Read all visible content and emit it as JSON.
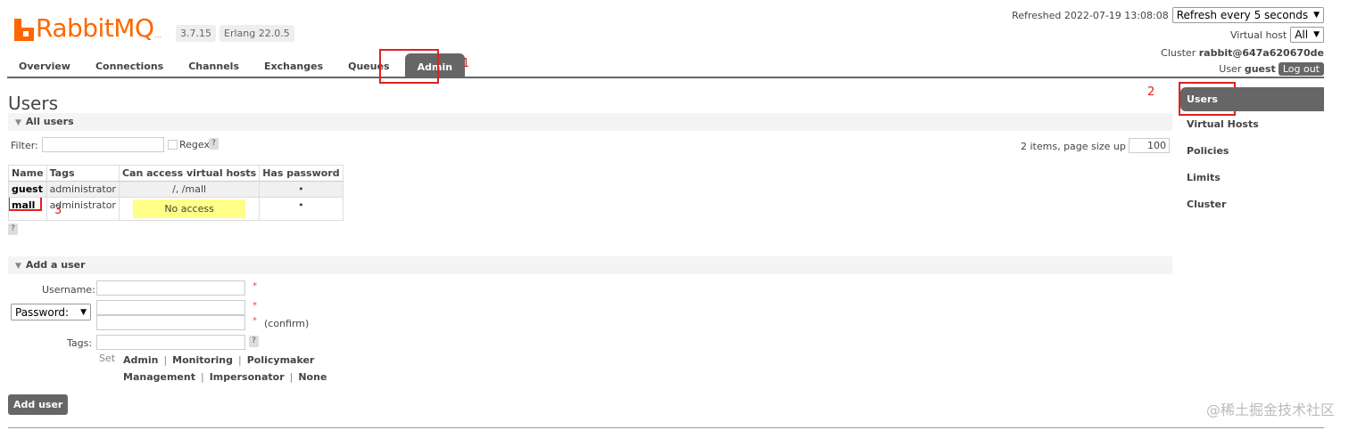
{
  "header": {
    "logo_text": "RabbitMQ",
    "logo_dots": "...",
    "version": "3.7.15",
    "erlang": "Erlang 22.0.5",
    "refreshed_label": "Refreshed 2022-07-19 13:08:08",
    "refresh_select": "Refresh every 5 seconds",
    "vhost_label": "Virtual host",
    "vhost_select": "All",
    "cluster_label": "Cluster",
    "cluster_name": "rabbit@647a620670de",
    "user_label": "User",
    "user_name": "guest",
    "logout": "Log out"
  },
  "nav": {
    "tabs": [
      "Overview",
      "Connections",
      "Channels",
      "Exchanges",
      "Queues",
      "Admin"
    ],
    "active": "Admin"
  },
  "sidebar": {
    "items": [
      "Users",
      "Virtual Hosts",
      "Policies",
      "Limits",
      "Cluster"
    ],
    "active": "Users"
  },
  "annotations": [
    "1",
    "2",
    "3"
  ],
  "page": {
    "title": "Users",
    "all_users_section": "All users",
    "filter_label": "Filter:",
    "regex_label": "Regex",
    "help": "?",
    "pagination": "2 items, page size up to",
    "page_size": "100"
  },
  "users_table": {
    "columns": [
      "Name",
      "Tags",
      "Can access virtual hosts",
      "Has password"
    ],
    "rows": [
      {
        "name": "guest",
        "tags": "administrator",
        "vhosts": "/, /mall",
        "has_password": "•"
      },
      {
        "name": "mall",
        "tags": "administrator",
        "vhosts": "No access",
        "has_password": "•"
      }
    ]
  },
  "add_user": {
    "section": "Add a user",
    "username_label": "Username:",
    "password_select": "Password:",
    "confirm": "(confirm)",
    "tags_label": "Tags:",
    "required_mark": "*",
    "set_label": "Set",
    "tag_options_row1": [
      "Admin",
      "Monitoring",
      "Policymaker"
    ],
    "tag_options_row2": [
      "Management",
      "Impersonator",
      "None"
    ],
    "separator": "|",
    "submit": "Add user"
  },
  "watermark": "@稀土掘金技术社区"
}
